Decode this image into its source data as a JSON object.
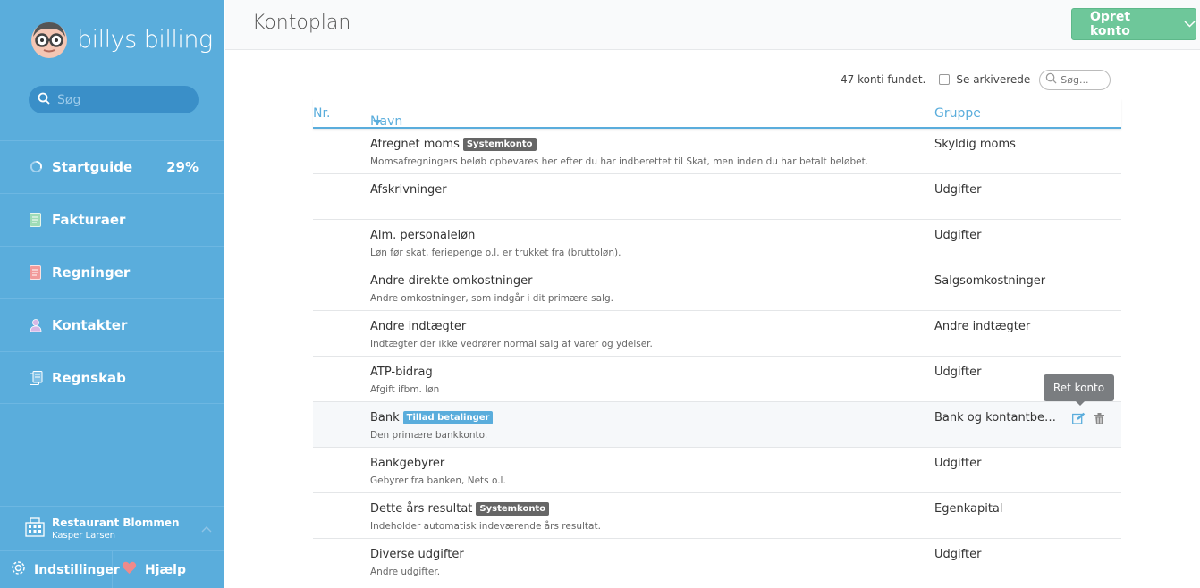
{
  "brand": {
    "name": "billys billing"
  },
  "sidebar": {
    "search_placeholder": "Søg",
    "items": [
      {
        "label": "Startguide",
        "icon": "progress-circle-icon",
        "extra": "29%"
      },
      {
        "label": "Fakturaer",
        "icon": "invoice-icon",
        "extra": ""
      },
      {
        "label": "Regninger",
        "icon": "bill-icon",
        "extra": ""
      },
      {
        "label": "Kontakter",
        "icon": "contact-person-icon",
        "extra": ""
      },
      {
        "label": "Regnskab",
        "icon": "accounting-icon",
        "extra": ""
      }
    ],
    "organization": {
      "name": "Restaurant Blommen",
      "user": "Kasper Larsen"
    },
    "settings_label": "Indstillinger",
    "help_label": "Hjælp"
  },
  "header": {
    "title": "Kontoplan",
    "create_label": "Opret konto"
  },
  "toolbar": {
    "count_text": "47 konti fundet.",
    "archived_label": "Se arkiverede",
    "search_placeholder": "Søg..."
  },
  "table": {
    "headers": {
      "nr": "Nr.",
      "name": "Navn",
      "group": "Gruppe"
    },
    "rows": [
      {
        "name": "Afregnet moms",
        "badge": "Systemkonto",
        "badge_type": "gray",
        "desc": "Momsafregningers beløb opbevares her efter du har indberettet til Skat, men inden du har betalt beløbet.",
        "group": "Skyldig moms"
      },
      {
        "name": "Afskrivninger",
        "badge": "",
        "badge_type": "",
        "desc": "",
        "group": "Udgifter"
      },
      {
        "name": "Alm. personaleløn",
        "badge": "",
        "badge_type": "",
        "desc": "Løn før skat, feriepenge o.l. er trukket fra (bruttoløn).",
        "group": "Udgifter"
      },
      {
        "name": "Andre direkte omkostninger",
        "badge": "",
        "badge_type": "",
        "desc": "Andre omkostninger, som indgår i dit primære salg.",
        "group": "Salgsomkostninger"
      },
      {
        "name": "Andre indtægter",
        "badge": "",
        "badge_type": "",
        "desc": "Indtægter der ikke vedrører normal salg af varer og ydelser.",
        "group": "Andre indtægter"
      },
      {
        "name": "ATP-bidrag",
        "badge": "",
        "badge_type": "",
        "desc": "Afgift ifbm. løn",
        "group": "Udgifter"
      },
      {
        "name": "Bank",
        "badge": "Tillad betalinger",
        "badge_type": "blue",
        "desc": "Den primære bankkonto.",
        "group": "Bank og kontantbeholdning"
      },
      {
        "name": "Bankgebyrer",
        "badge": "",
        "badge_type": "",
        "desc": "Gebyrer fra banken, Nets o.l.",
        "group": "Udgifter"
      },
      {
        "name": "Dette års resultat",
        "badge": "Systemkonto",
        "badge_type": "gray",
        "desc": "Indeholder automatisk indeværende års resultat.",
        "group": "Egenkapital"
      },
      {
        "name": "Diverse udgifter",
        "badge": "",
        "badge_type": "",
        "desc": "Andre udgifter.",
        "group": "Udgifter"
      }
    ],
    "tooltip": "Ret konto"
  },
  "colors": {
    "sidebar": "#5aaddc",
    "accent": "#5aaddc",
    "create_button": "#6ec79a"
  }
}
